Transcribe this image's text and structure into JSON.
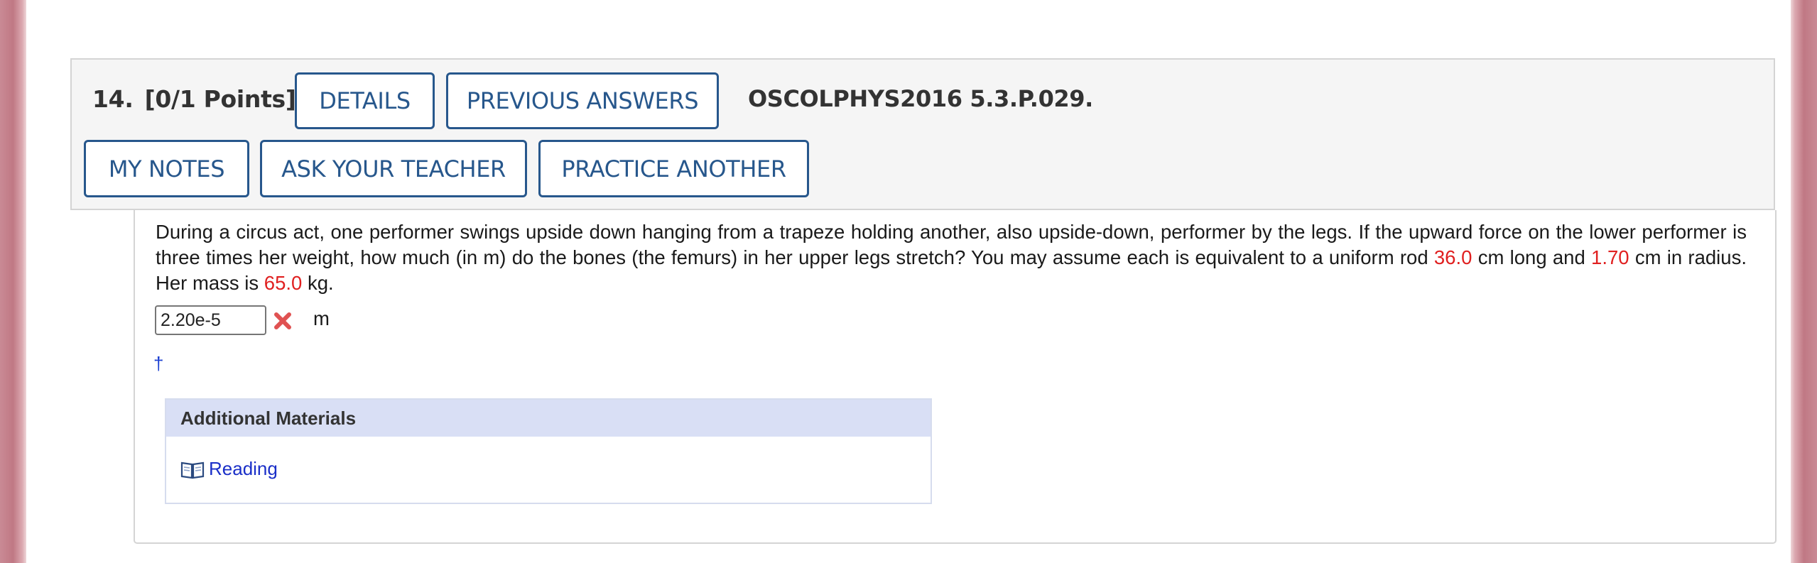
{
  "question": {
    "number": "14.",
    "points": "[0/1 Points]",
    "code": "OSCOLPHYS2016 5.3.P.029."
  },
  "buttons": {
    "details": "DETAILS",
    "previous_answers": "PREVIOUS ANSWERS",
    "my_notes": "MY NOTES",
    "ask_teacher": "ASK YOUR TEACHER",
    "practice_another": "PRACTICE ANOTHER"
  },
  "problem": {
    "text_1": "During a circus act, one performer swings upside down hanging from a trapeze holding another, also upside-down, performer by the legs. If the upward force on the lower performer is three times her weight, how much (in m) do the bones (the femurs) in her upper legs stretch? You may assume each is equivalent to a uniform rod ",
    "value_length": "36.0",
    "text_2": " cm long and ",
    "value_radius": "1.70",
    "text_3": " cm in radius. Her mass is ",
    "value_mass": "65.0",
    "text_4": " kg."
  },
  "answer": {
    "value": "2.20e-5",
    "unit": "m",
    "status_icon": "incorrect-x-icon"
  },
  "footnote": "†",
  "materials": {
    "heading": "Additional Materials",
    "link_icon": "book-icon",
    "link_label": "Reading"
  },
  "colors": {
    "button_border": "#27578c",
    "given_value": "#e02020",
    "incorrect_mark": "#e05252",
    "materials_header": "#d9dff5",
    "link": "#1a2fc8"
  }
}
